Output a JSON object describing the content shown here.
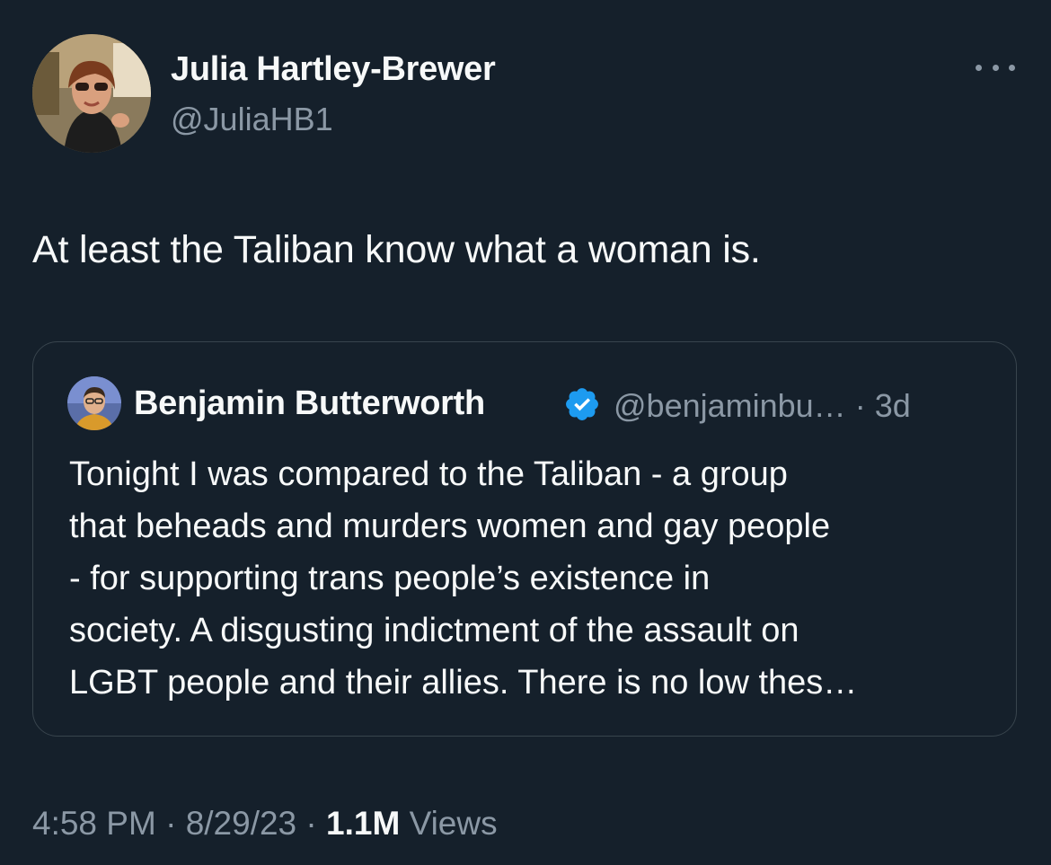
{
  "author": {
    "name": "Julia Hartley-Brewer",
    "handle": "@JuliaHB1"
  },
  "tweet": {
    "text": "At least the Taliban know what a woman is."
  },
  "more_icon": "more-horizontal-icon",
  "quoted_tweet": {
    "name": "Benjamin Butterworth",
    "verified_icon": "verified-badge-icon",
    "handle": "@benjaminbu…",
    "separator": "·",
    "age": "3d",
    "lines": [
      "Tonight I was compared to the Taliban - a group",
      "that beheads and murders women and gay people",
      "- for supporting trans people’s existence in",
      "society. A disgusting indictment of the assault on",
      "LGBT people and their allies. There is no low thes…"
    ]
  },
  "meta": {
    "time": "4:58 PM",
    "separator": "·",
    "date": "8/29/23",
    "views_count": "1.1M",
    "views_label": "Views"
  },
  "colors": {
    "background": "#15202b",
    "primary_text": "#f7f9f9",
    "secondary_text": "#8b98a5",
    "border": "#38444d",
    "verified": "#1d9bf0"
  }
}
